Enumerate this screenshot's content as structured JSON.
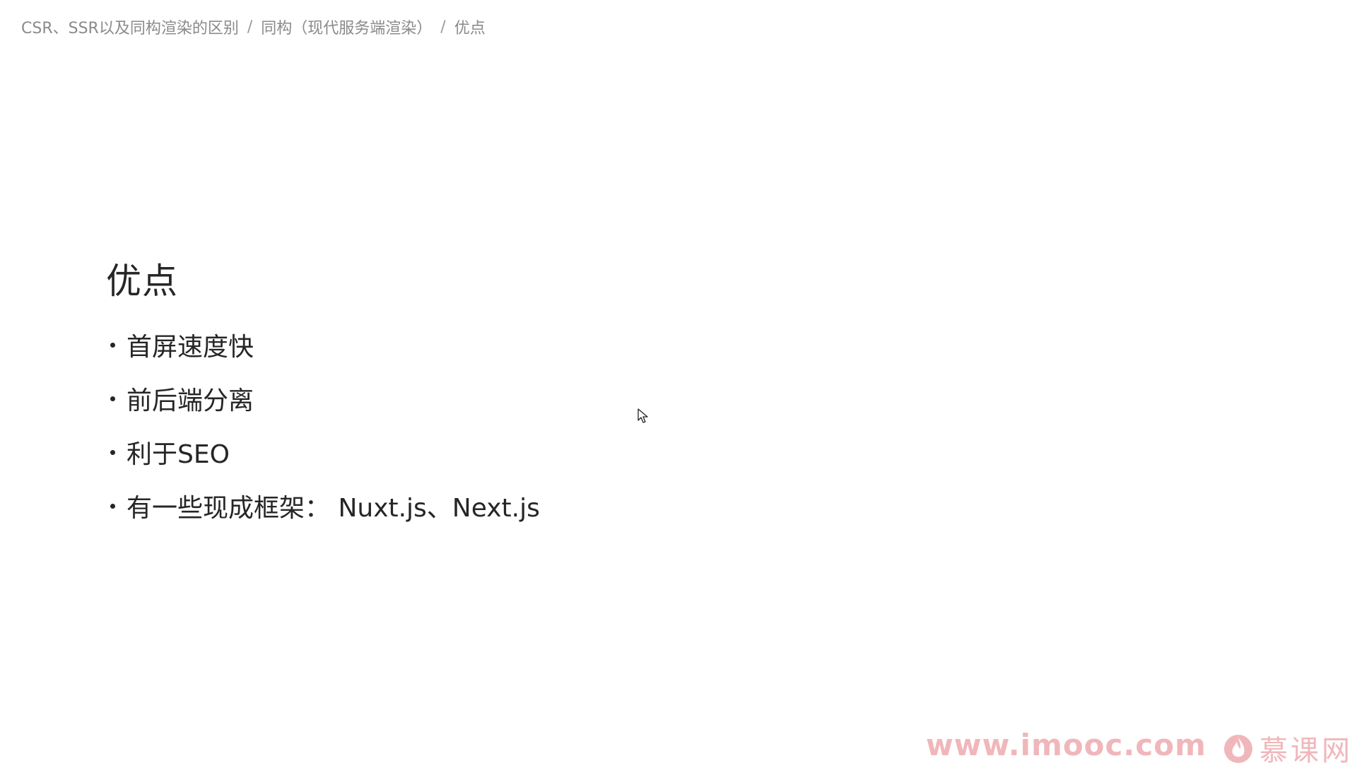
{
  "breadcrumb": {
    "items": [
      "CSR、SSR以及同构渲染的区别",
      "同构（现代服务端渲染）",
      "优点"
    ],
    "separator": "/"
  },
  "slide": {
    "title": "优点",
    "bullets": [
      "首屏速度快",
      "前后端分离",
      "利于SEO",
      "有一些现成框架： Nuxt.js、Next.js"
    ]
  },
  "watermark": {
    "url": "www.imooc.com",
    "brand": "慕课网",
    "icon": "flame-logo-icon",
    "color": "#f0b7bb"
  },
  "cursor": {
    "icon": "mouse-pointer-icon"
  }
}
